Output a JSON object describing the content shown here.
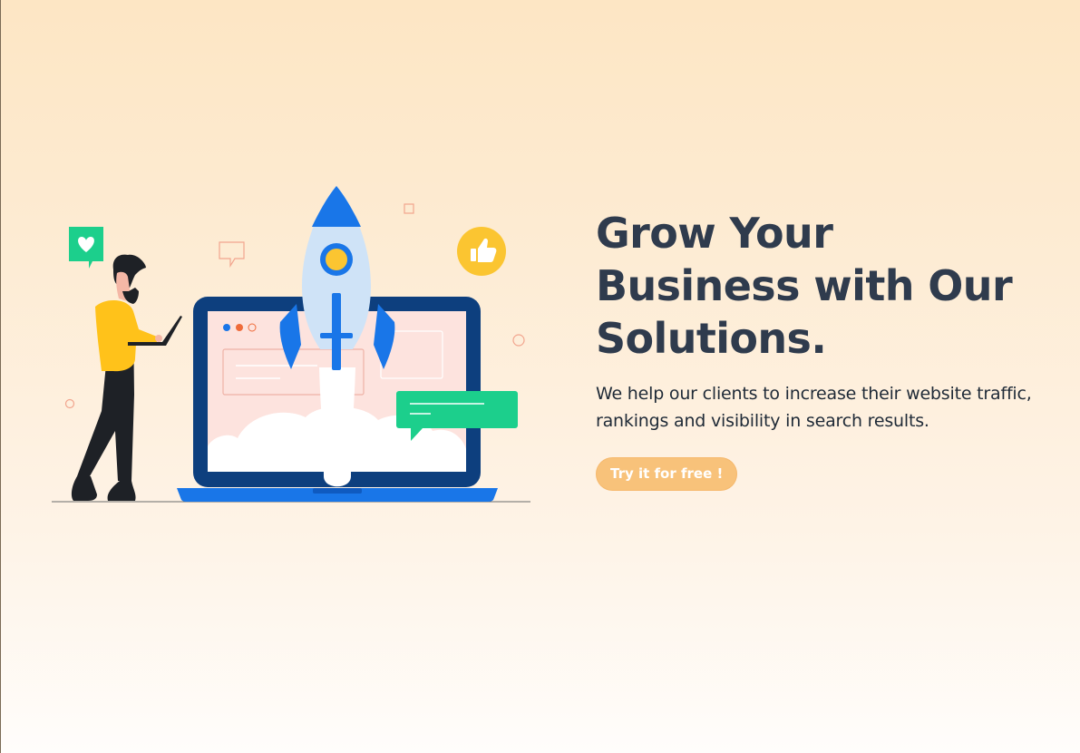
{
  "hero": {
    "headline": "Grow Your Business with Our Solutions.",
    "subtext": "We help our clients to increase their website traffic, rankings and visibility in search results.",
    "cta_label": "Try it for free !"
  },
  "illustration": {
    "description": "",
    "icons": [
      "heart-icon",
      "thumbs-up-icon",
      "chat-bubble-icon",
      "rocket-icon"
    ]
  },
  "colors": {
    "headline": "#2f3b4d",
    "cta_bg": "#f8c27a",
    "accent_blue": "#1976e8",
    "accent_green": "#1ccf8c",
    "accent_yellow": "#fbc531"
  }
}
